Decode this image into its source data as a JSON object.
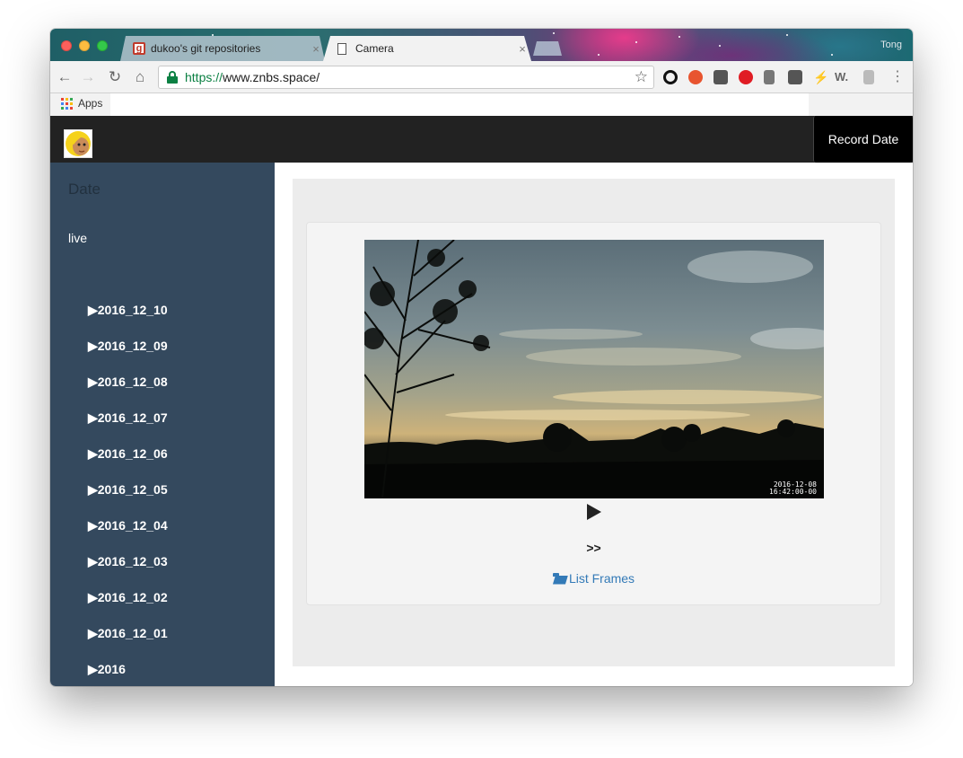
{
  "browser": {
    "tabs": [
      {
        "title": "dukoo's git repositories",
        "close": "×",
        "active": false
      },
      {
        "title": "Camera",
        "close": "×",
        "active": true
      }
    ],
    "profile": "Tong",
    "url_scheme": "https://",
    "url_host": "www.znbs.space/",
    "bookmarks_apps": "Apps",
    "icons": {
      "back": "←",
      "forward": "→",
      "reload": "↻",
      "home": "⌂",
      "star": "☆",
      "menu": "⋮",
      "flash": "⚡",
      "w": "W."
    }
  },
  "navbar": {
    "record_label": "Record Date"
  },
  "sidebar": {
    "header": "Date",
    "live": "live",
    "items": [
      "▶2016_12_10",
      "▶2016_12_09",
      "▶2016_12_08",
      "▶2016_12_07",
      "▶2016_12_06",
      "▶2016_12_05",
      "▶2016_12_04",
      "▶2016_12_03",
      "▶2016_12_02",
      "▶2016_12_01",
      "▶2016"
    ]
  },
  "main": {
    "timestamp_date": "2016-12-08",
    "timestamp_time": "16:42:00-00",
    "next_label": ">>",
    "list_frames_label": "List Frames"
  },
  "colors": {
    "navbar": "#222222",
    "sidebar": "#34495e",
    "link": "#337ab7",
    "secure_url": "#0b8043"
  }
}
